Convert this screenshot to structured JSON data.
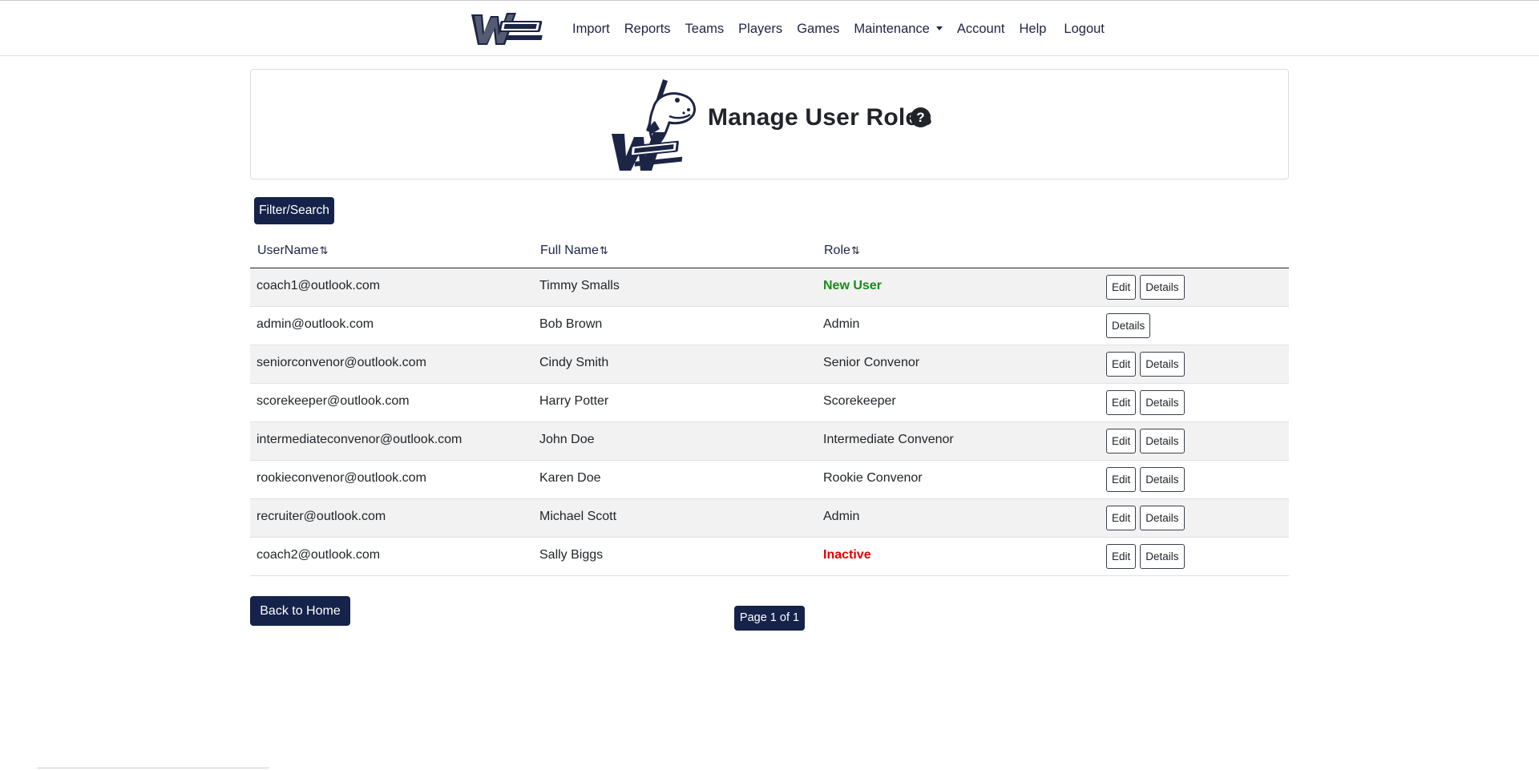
{
  "nav": {
    "brand_alt": "Welland minor baseball",
    "links": [
      "Import",
      "Reports",
      "Teams",
      "Players",
      "Games",
      "Maintenance",
      "Account",
      "Help",
      "Logout"
    ]
  },
  "header": {
    "title": "Manage User Roles",
    "help": "?"
  },
  "toolbar": {
    "filter_label": "Filter/Search"
  },
  "table": {
    "columns": [
      "UserName",
      "Full Name",
      "Role"
    ],
    "sort_glyph": "⇅",
    "rows": [
      {
        "username": "coach1@outlook.com",
        "fullname": "Timmy Smalls",
        "role": "New User",
        "edit": "Edit",
        "details": "Details"
      },
      {
        "username": "admin@outlook.com",
        "fullname": "Bob Brown",
        "role": "Admin",
        "details": "Details"
      },
      {
        "username": "seniorconvenor@outlook.com",
        "fullname": "Cindy Smith",
        "role": "Senior Convenor",
        "edit": "Edit",
        "details": "Details"
      },
      {
        "username": "scorekeeper@outlook.com",
        "fullname": "Harry Potter",
        "role": "Scorekeeper",
        "edit": "Edit",
        "details": "Details"
      },
      {
        "username": "intermediateconvenor@outlook.com",
        "fullname": "John Doe",
        "role": "Intermediate Convenor",
        "edit": "Edit",
        "details": "Details"
      },
      {
        "username": "rookieconvenor@outlook.com",
        "fullname": "Karen Doe",
        "role": "Rookie Convenor",
        "edit": "Edit",
        "details": "Details"
      },
      {
        "username": "recruiter@outlook.com",
        "fullname": "Michael Scott",
        "role": "Admin",
        "edit": "Edit",
        "details": "Details"
      },
      {
        "username": "coach2@outlook.com",
        "fullname": "Sally Biggs",
        "role": "Inactive",
        "edit": "Edit",
        "details": "Details"
      }
    ]
  },
  "footer": {
    "back_label": "Back to Home",
    "page_label": "Page 1 of 1"
  },
  "colors": {
    "primary": "#15234a",
    "role_new": "#1a8a1a",
    "role_inactive": "#e00000",
    "stripe": "#f2f2f2"
  }
}
